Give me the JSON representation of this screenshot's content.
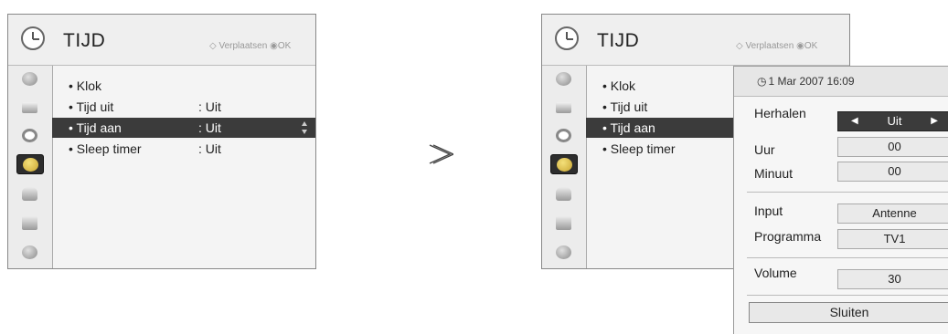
{
  "left_menu": {
    "title": "TIJD",
    "hint": "Verplaatsen",
    "hint_ok": "OK",
    "items": [
      {
        "label": "• Klok",
        "value": ""
      },
      {
        "label": "• Tijd uit",
        "value": ": Uit"
      },
      {
        "label": "• Tijd aan",
        "value": ": Uit"
      },
      {
        "label": "• Sleep timer",
        "value": ": Uit"
      }
    ],
    "selected_index": 2
  },
  "right_menu": {
    "title": "TIJD",
    "hint": "Verplaatsen",
    "hint_ok": "OK",
    "items": [
      {
        "label": "• Klok"
      },
      {
        "label": "• Tijd uit"
      },
      {
        "label": "• Tijd aan"
      },
      {
        "label": "• Sleep timer"
      }
    ]
  },
  "separator": ">",
  "popup": {
    "datetime": "1 Mar 2007 16:09",
    "fields": [
      {
        "label": "Herhalen",
        "value": "Uit",
        "arrows": true
      },
      {
        "label": "Uur",
        "value": "00"
      },
      {
        "label": "Minuut",
        "value": "00"
      },
      {
        "label": "Input",
        "value": "Antenne"
      },
      {
        "label": "Programma",
        "value": "TV1"
      },
      {
        "label": "Volume",
        "value": "30"
      }
    ],
    "close_label": "Sluiten"
  },
  "sidebar_icons": [
    "satellite-dish-icon",
    "tv-screen-icon",
    "speaker-icon",
    "clock-icon",
    "lock-icon",
    "briefcase-icon",
    "globe-icon"
  ],
  "colors": {
    "selected_bg": "#3b3b3b",
    "active_icon": "#c9a531"
  }
}
